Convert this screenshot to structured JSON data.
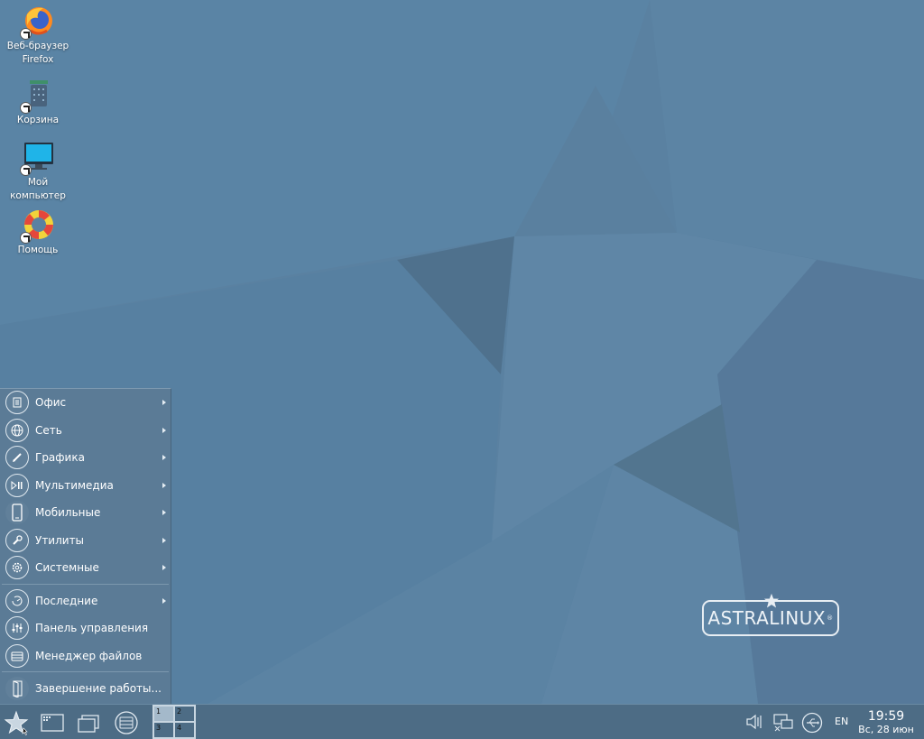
{
  "desktop": {
    "icons": [
      {
        "label": "Веб-браузер\nFirefox",
        "icon": "firefox-icon"
      },
      {
        "label": "Корзина",
        "icon": "trash-icon"
      },
      {
        "label": "Мой\nкомпьютер",
        "icon": "computer-icon"
      },
      {
        "label": "Помощь",
        "icon": "help-icon"
      }
    ]
  },
  "logo": {
    "text": "ASTRALINUX",
    "reg": "®"
  },
  "start_menu": {
    "items": [
      {
        "label": "Офис",
        "icon": "office-icon",
        "submenu": true
      },
      {
        "label": "Сеть",
        "icon": "network-globe-icon",
        "submenu": true
      },
      {
        "label": "Графика",
        "icon": "pencil-icon",
        "submenu": true
      },
      {
        "label": "Мультимедиа",
        "icon": "multimedia-icon",
        "submenu": true
      },
      {
        "label": "Мобильные",
        "icon": "mobile-icon",
        "submenu": true
      },
      {
        "label": "Утилиты",
        "icon": "wrench-icon",
        "submenu": true
      },
      {
        "label": "Системные",
        "icon": "gear-icon",
        "submenu": true
      }
    ],
    "items2": [
      {
        "label": "Последние",
        "icon": "recent-icon",
        "submenu": true
      },
      {
        "label": "Панель управления",
        "icon": "control-panel-icon",
        "submenu": false
      },
      {
        "label": "Менеджер файлов",
        "icon": "file-manager-icon",
        "submenu": false
      }
    ],
    "shutdown": {
      "label": "Завершение работы...",
      "icon": "exit-door-icon"
    }
  },
  "taskbar": {
    "pager": [
      "1",
      "2",
      "3",
      "4"
    ],
    "active_desktop": "1",
    "lang": "EN",
    "time": "19:59",
    "date": "Вс, 28 июн"
  },
  "colors": {
    "wallpaper": "#5a81a1",
    "menu_bg": "#5b7b96",
    "taskbar_bg": "#4d6c85"
  }
}
